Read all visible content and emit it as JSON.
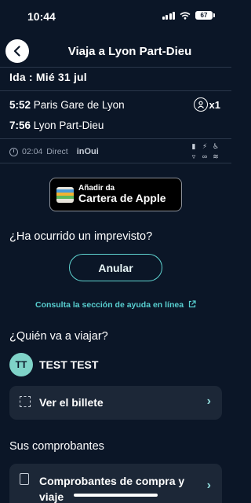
{
  "status_bar": {
    "time": "10:44",
    "battery": "67"
  },
  "header": {
    "title": "Viaja a Lyon Part-Dieu"
  },
  "trip": {
    "date_line": "Ida : Mié 31 jul",
    "departure": {
      "time": "5:52",
      "station": "Paris Gare de Lyon"
    },
    "arrival": {
      "time": "7:56",
      "station": "Lyon Part-Dieu"
    },
    "passengers": "x1",
    "duration": "02:04",
    "type": "Direct",
    "brand": "inOui"
  },
  "wallet_button": {
    "line1": "Añadir da",
    "line2": "Cartera de Apple"
  },
  "incident": {
    "question": "¿Ha ocurrido un imprevisto?",
    "cancel_label": "Anular"
  },
  "help_link": "Consulta la sección de ayuda en línea",
  "travellers": {
    "question": "¿Quién va a viajar?",
    "initials": "TT",
    "name": "TEST TEST",
    "ticket_label": "Ver el billete"
  },
  "receipts": {
    "title": "Sus comprobantes",
    "item_label_line1": "Comprobantes de compra y",
    "item_label_line2": "viaje"
  },
  "colors": {
    "background": "#0b1627",
    "accent": "#5fd3d0",
    "card": "#1c2737"
  }
}
